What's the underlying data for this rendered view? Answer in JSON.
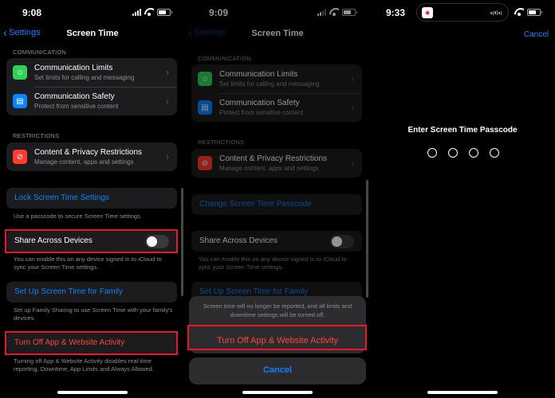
{
  "panel1": {
    "time": "9:08",
    "back_label": "Settings",
    "title": "Screen Time",
    "communication_header": "COMMUNICATION",
    "comm_limits_title": "Communication Limits",
    "comm_limits_sub": "Set limits for calling and messaging",
    "comm_safety_title": "Communication Safety",
    "comm_safety_sub": "Protect from sensitive content",
    "restrictions_header": "RESTRICTIONS",
    "content_title": "Content & Privacy Restrictions",
    "content_sub": "Manage content, apps and settings",
    "lock_label": "Lock Screen Time Settings",
    "lock_note": "Use a passcode to secure Screen Time settings.",
    "share_label": "Share Across Devices",
    "share_on": false,
    "share_note": "You can enable this on any device signed in to iCloud to sync your Screen Time settings.",
    "family_label": "Set Up Screen Time for Family",
    "family_note": "Set up Family Sharing to use Screen Time with your family's devices.",
    "turnoff_label": "Turn Off App & Website Activity",
    "turnoff_note": "Turning off App & Website Activity disables real-time reporting, Downtime, App Limits and Always Allowed."
  },
  "panel2": {
    "time": "9:09",
    "back_label": "Settings",
    "title": "Screen Time",
    "communication_header": "COMMUNICATION",
    "comm_limits_title": "Communication Limits",
    "comm_limits_sub": "Set limits for calling and messaging",
    "comm_safety_title": "Communication Safety",
    "comm_safety_sub": "Protect from sensitive content",
    "restrictions_header": "RESTRICTIONS",
    "content_title": "Content & Privacy Restrictions",
    "content_sub": "Manage content, apps and settings",
    "change_label": "Change Screen Time Passcode",
    "share_label": "Share Across Devices",
    "share_on": false,
    "share_note": "You can enable this on any device signed in to iCloud to sync your Screen Time settings.",
    "family_label": "Set Up Screen Time for Family",
    "sheet_message": "Screen time will no longer be reported, and all limits and downtime settings will be turned off.",
    "sheet_action": "Turn Off App & Website Activity",
    "cancel_label": "Cancel"
  },
  "panel3": {
    "time": "9:33",
    "cancel_label": "Cancel",
    "prompt": "Enter Screen Time Passcode",
    "passcode_length": 4
  },
  "colors": {
    "accent_blue": "#0a84ff",
    "destructive_red": "#ff453a",
    "highlight_box": "#e8162b",
    "green_icon": "#30d158",
    "blue_icon": "#0a84ff",
    "red_icon": "#ff3b30"
  },
  "icons": {
    "comm_limits": "person-circle-icon",
    "comm_safety": "chat-bubbles-icon",
    "content": "no-entry-icon"
  }
}
